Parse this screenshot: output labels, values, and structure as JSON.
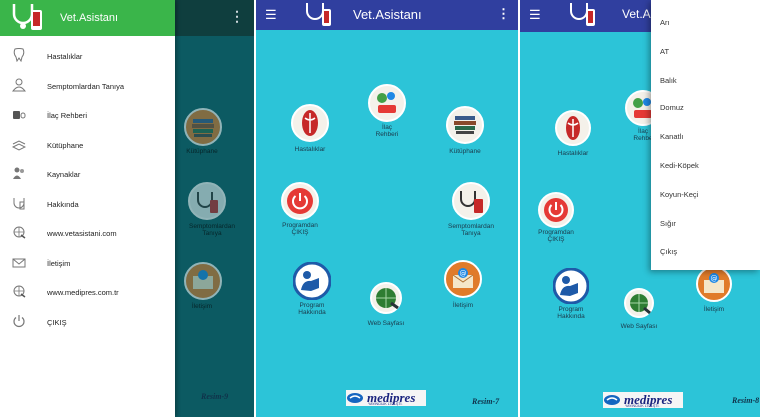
{
  "panel1": {
    "drawer": {
      "title": "Vet.Asistanı",
      "items": [
        {
          "label": "Hastalıklar",
          "icon": "tooth-icon"
        },
        {
          "label": "Semptomlardan Tanıya",
          "icon": "user-icon"
        },
        {
          "label": "İlaç Rehberi",
          "icon": "pills-icon"
        },
        {
          "label": "Kütüphane",
          "icon": "books-icon"
        },
        {
          "label": "Kaynaklar",
          "icon": "people-icon"
        },
        {
          "label": "Hakkında",
          "icon": "info-icon"
        },
        {
          "label": "www.vetasistani.com",
          "icon": "globe-icon"
        },
        {
          "label": "İletişim",
          "icon": "mail-icon"
        },
        {
          "label": "www.medipres.com.tr",
          "icon": "globe-icon"
        },
        {
          "label": "ÇIKIŞ",
          "icon": "power-icon"
        }
      ]
    },
    "dimmed_labels": {
      "kutuphane": "Kütüphane",
      "semptom": "Semptomlardan\nTanıya",
      "iletisim": "İletişim"
    },
    "resim": "Resim-9"
  },
  "panel2": {
    "title": "Vet.Asistanı",
    "icons": {
      "hastaliklar": "Hastalıklar",
      "ilac": "İlaç\nRehberi",
      "kutuphane": "Kütüphane",
      "cikis": "Programdan\nÇIKIŞ",
      "semptom": "Semptomlardan\nTanıya",
      "hakkinda": "Program\nHakkında",
      "web": "Web Sayfası",
      "iletisim": "İletişim"
    },
    "brand": "medipres",
    "brand_sub": "YAYINCILIK LTD. ŞTİ.",
    "resim": "Resim-7"
  },
  "panel3": {
    "title": "Vet.As",
    "icons": {
      "hastaliklar": "Hastalıklar",
      "ilac": "İlaç\nRehbe",
      "cikis": "Programdan\nÇIKIŞ",
      "hakkinda": "Program\nHakkında",
      "web": "Web Sayfası",
      "iletisim": "İletişim"
    },
    "menu": [
      "Arı",
      "AT",
      "Balık",
      "Domuz",
      "Kanatlı",
      "Kedi-Köpek",
      "Koyun-Keçi",
      "Sığır",
      "Çıkış"
    ],
    "brand": "medipres",
    "brand_sub": "YAYINCILIK LTD. ŞTİ.",
    "resim": "Resim-8"
  },
  "colors": {
    "teal_bg": "#2cc4d8",
    "appbar": "#303f9f",
    "drawer_header": "#3ab54a",
    "dim_bg": "#0c5a62"
  }
}
